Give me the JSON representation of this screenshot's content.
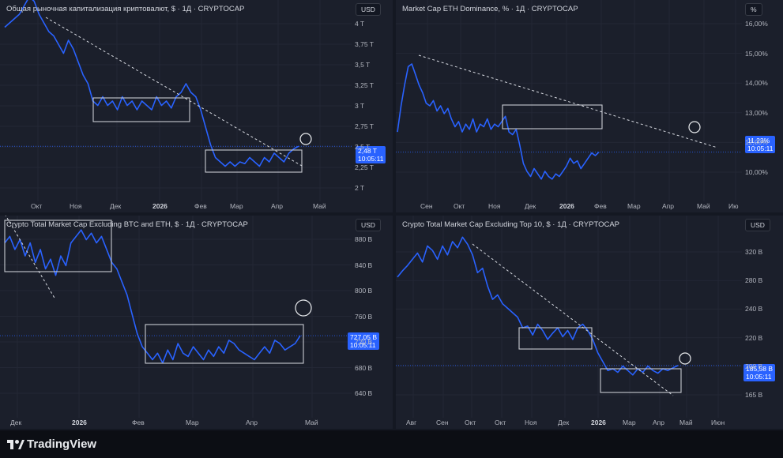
{
  "brand": {
    "name": "TradingView"
  },
  "colors": {
    "line": "#2962ff",
    "badge": "#2962ff",
    "bg": "#1b1f2b"
  },
  "chart_data": [
    {
      "type": "line",
      "title": "Общая рыночная капитализация криптовалют, $ · 1Д · CRYPTOCAP",
      "currency_label": "USD",
      "y_ticks": [
        "4 T",
        "3,75 T",
        "3,5 T",
        "3,25 T",
        "3 T",
        "2,75 T",
        "2,5 T",
        "2,25 T",
        "2 T"
      ],
      "x_ticks": [
        "Окт",
        "Ноя",
        "Дек",
        "2026",
        "Фев",
        "Мар",
        "Апр",
        "Май"
      ],
      "last_value_label": "2,48 T",
      "last_time_label": "10:05:11",
      "ylim": [
        2.0,
        4.0
      ],
      "series": [
        {
          "values": [
            3.85,
            3.9,
            3.95,
            4.0,
            4.1,
            4.2,
            4.15,
            4.0,
            3.9,
            3.8,
            3.75,
            3.65,
            3.55,
            3.7,
            3.6,
            3.45,
            3.3,
            3.2,
            3.0,
            2.95,
            3.05,
            2.95,
            3.0,
            2.9,
            3.05,
            2.95,
            3.0,
            2.9,
            3.0,
            2.95,
            2.9,
            3.05,
            2.95,
            3.0,
            2.92,
            3.05,
            3.1,
            3.2,
            3.1,
            3.05,
            2.9,
            2.7,
            2.5,
            2.35,
            2.3,
            2.25,
            2.3,
            2.25,
            2.3,
            2.28,
            2.35,
            2.3,
            2.25,
            2.35,
            2.3,
            2.4,
            2.35,
            2.3,
            2.4,
            2.45,
            2.48
          ]
        }
      ]
    },
    {
      "type": "line",
      "title": "Market Cap ETH Dominance, % · 1Д · CRYPTOCAP",
      "currency_label": "%",
      "y_ticks": [
        "16,00%",
        "15,00%",
        "14,00%",
        "13,00%",
        "12,00%",
        "10,00%"
      ],
      "x_ticks": [
        "Сен",
        "Окт",
        "Ноя",
        "Дек",
        "2026",
        "Фев",
        "Мар",
        "Апр",
        "Май",
        "Ию"
      ],
      "last_value_label": "11,23%",
      "last_time_label": "10:05:11",
      "ylim": [
        9.5,
        16.5
      ],
      "series": [
        {
          "values": [
            12.0,
            13.0,
            13.8,
            14.5,
            14.6,
            14.2,
            13.8,
            13.5,
            13.1,
            13.0,
            13.2,
            12.8,
            13.0,
            12.7,
            12.9,
            12.5,
            12.2,
            12.4,
            12.0,
            12.3,
            12.1,
            12.5,
            12.0,
            12.3,
            12.2,
            12.5,
            12.1,
            12.3,
            12.2,
            12.4,
            12.6,
            12.0,
            11.9,
            12.1,
            11.5,
            10.8,
            10.5,
            10.3,
            10.6,
            10.4,
            10.2,
            10.5,
            10.3,
            10.2,
            10.4,
            10.3,
            10.5,
            10.7,
            11.0,
            10.8,
            10.9,
            10.6,
            10.8,
            11.0,
            11.2,
            11.1,
            11.23
          ]
        }
      ]
    },
    {
      "type": "line",
      "title": "Crypto Total Market Cap Excluding BTC and ETH, $ · 1Д · CRYPTOCAP",
      "currency_label": "USD",
      "y_ticks": [
        "880 B",
        "840 B",
        "800 B",
        "760 B",
        "720 B",
        "680 B",
        "640 B"
      ],
      "x_ticks": [
        "Дек",
        "2026",
        "Фев",
        "Мар",
        "Апр",
        "Май"
      ],
      "last_value_label": "727,05 B",
      "last_time_label": "10:05:11",
      "ylim": [
        620,
        900
      ],
      "series": [
        {
          "values": [
            870,
            880,
            860,
            875,
            850,
            870,
            840,
            860,
            830,
            845,
            820,
            850,
            835,
            870,
            880,
            890,
            875,
            885,
            870,
            880,
            860,
            840,
            830,
            810,
            790,
            760,
            730,
            710,
            700,
            690,
            700,
            685,
            705,
            690,
            715,
            700,
            695,
            710,
            700,
            690,
            705,
            695,
            710,
            700,
            720,
            715,
            705,
            700,
            695,
            690,
            700,
            710,
            700,
            720,
            715,
            705,
            710,
            715,
            727
          ]
        }
      ]
    },
    {
      "type": "line",
      "title": "Crypto Total Market Cap Excluding Top 10, $ · 1Д · CRYPTOCAP",
      "currency_label": "USD",
      "y_ticks": [
        "320 B",
        "280 B",
        "240 B",
        "220 B",
        "200 B",
        "165 B"
      ],
      "x_ticks": [
        "Авг",
        "Сен",
        "Окт",
        "Окт",
        "Ноя",
        "Дек",
        "2026",
        "Мар",
        "Апр",
        "Май",
        "Июн"
      ],
      "last_value_label": "185,58 B",
      "last_time_label": "10:05:11",
      "ylim": [
        150,
        340
      ],
      "series": [
        {
          "values": [
            285,
            292,
            298,
            305,
            312,
            302,
            320,
            315,
            305,
            320,
            310,
            325,
            318,
            330,
            322,
            310,
            290,
            295,
            275,
            260,
            265,
            255,
            250,
            245,
            240,
            228,
            230,
            220,
            232,
            225,
            215,
            222,
            228,
            218,
            225,
            215,
            228,
            232,
            225,
            215,
            200,
            190,
            180,
            182,
            178,
            185,
            180,
            175,
            182,
            178,
            185,
            180,
            177,
            182,
            180,
            183,
            185.58
          ]
        }
      ]
    }
  ]
}
